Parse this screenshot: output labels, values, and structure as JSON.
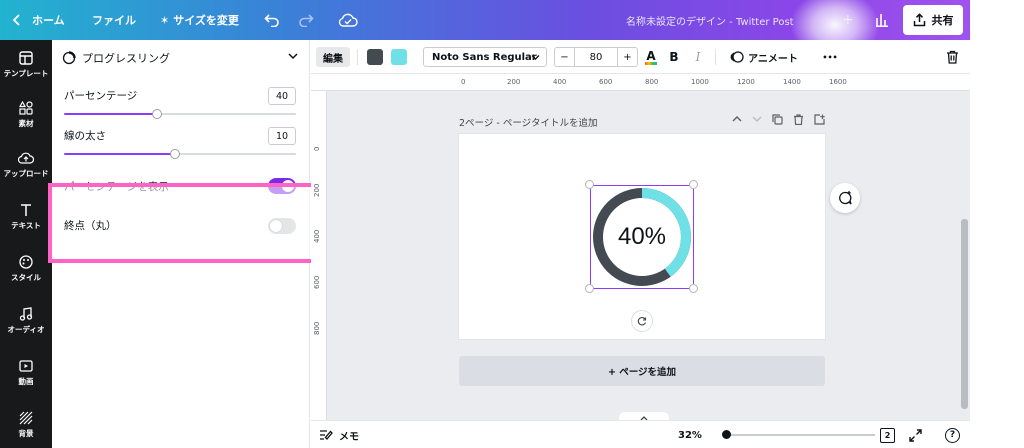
{
  "topbar": {
    "home_label": "ホーム",
    "file_label": "ファイル",
    "resize_label": "サイズを変更",
    "resize_prefix": "✶",
    "document_title": "名称未設定のデザイン - Twitter Post",
    "share_label": "共有"
  },
  "rail": {
    "items": [
      {
        "label": "テンプレート",
        "icon": "template-icon"
      },
      {
        "label": "素材",
        "icon": "elements-icon"
      },
      {
        "label": "アップロード",
        "icon": "upload-icon"
      },
      {
        "label": "テキスト",
        "icon": "text-icon"
      },
      {
        "label": "スタイル",
        "icon": "style-icon"
      },
      {
        "label": "オーディオ",
        "icon": "audio-icon"
      },
      {
        "label": "動画",
        "icon": "video-icon"
      },
      {
        "label": "背景",
        "icon": "background-icon"
      }
    ]
  },
  "panel": {
    "title": "プログレスリング",
    "percentage": {
      "label": "パーセンテージ",
      "value": "40",
      "fraction": 0.4
    },
    "stroke_width": {
      "label": "線の太さ",
      "value": "10",
      "fraction": 0.48
    },
    "hidden_toggle_label": "パーセンテージを表示",
    "rounded_end": {
      "label": "終点（丸）",
      "on": false
    }
  },
  "toolbar": {
    "edit_label": "編集",
    "color_1": "#444a52",
    "color_2": "#6fe0e6",
    "font_name": "Noto Sans Regular",
    "font_size": "80",
    "minus": "−",
    "plus": "+",
    "bold": "B",
    "italic": "I",
    "text_color_glyph": "A",
    "animate_label": "アニメート",
    "more": "•••"
  },
  "ruler": {
    "h_ticks": [
      "0",
      "200",
      "400",
      "600",
      "800",
      "1000",
      "1200",
      "1400",
      "1600"
    ],
    "v_ticks": [
      "0",
      "200",
      "400",
      "600",
      "800"
    ]
  },
  "page": {
    "header": "2ページ - ページタイトルを追加",
    "ring_text": "40%",
    "ring_progress": 0.4,
    "ring_track_color": "#444a52",
    "ring_progress_color": "#6fe0e6",
    "add_page_label": "+ ページを追加"
  },
  "bottombar": {
    "notes_label": "メモ",
    "zoom": "32%",
    "zoom_fraction": 0.0,
    "page_count": "2",
    "help": "?"
  },
  "colors": {
    "accent": "#8b3dff",
    "highlight": "#ff63c6"
  }
}
